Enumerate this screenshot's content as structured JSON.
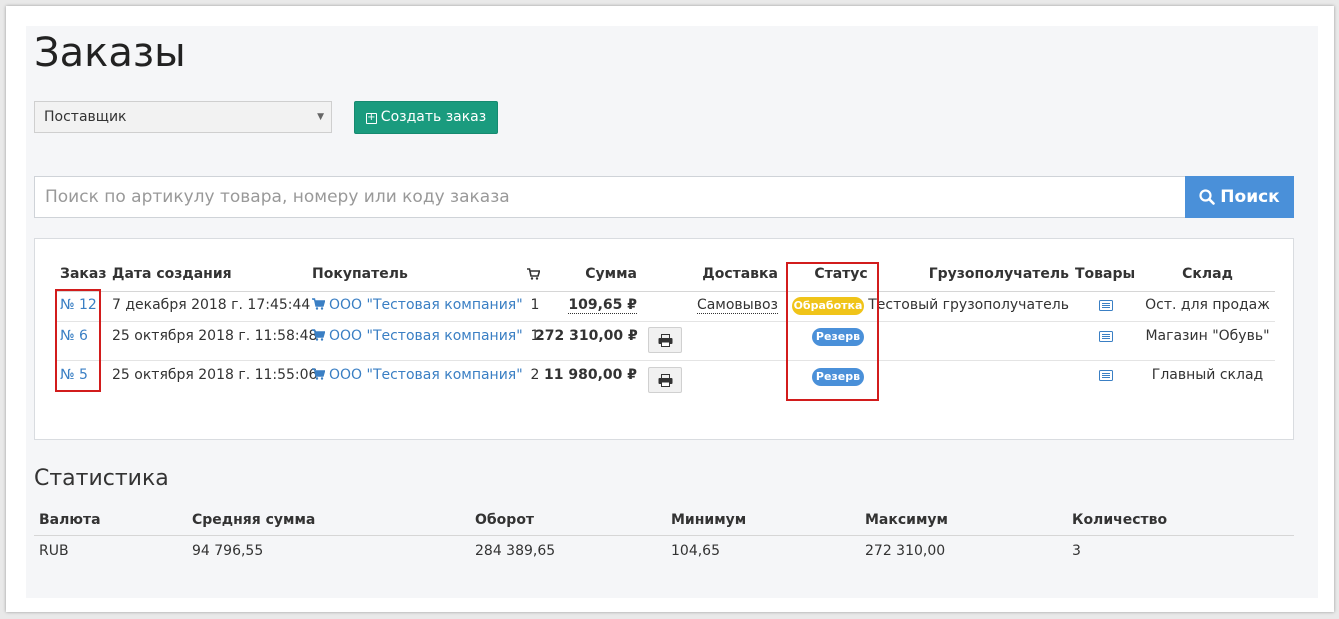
{
  "page": {
    "title": "Заказы"
  },
  "filters": {
    "supplier_value": "Поставщик",
    "create_label": "Создать заказ"
  },
  "search": {
    "placeholder": "Поиск по артикулу товара, номеру или коду заказа",
    "button_label": "Поиск"
  },
  "orders_table": {
    "headers": {
      "order": "Заказ",
      "date": "Дата создания",
      "buyer": "Покупатель",
      "sum": "Сумма",
      "delivery": "Доставка",
      "status": "Статус",
      "consignee": "Грузополучатель",
      "goods": "Товары",
      "warehouse": "Склад"
    },
    "rows": [
      {
        "order": "№ 12",
        "date": "7 декабря 2018 г. 17:45:44",
        "buyer": "ООО \"Тестовая компания\"",
        "qty": "1",
        "sum": "109,65 ₽",
        "delivery": "Самовывоз",
        "status": "Обработка",
        "consignee": "Тестовый грузополучатель",
        "warehouse": "Ост. для продаж"
      },
      {
        "order": "№ 6",
        "date": "25 октября 2018 г. 11:58:48",
        "buyer": "ООО \"Тестовая компания\"",
        "qty": "1",
        "sum": "272 310,00 ₽",
        "delivery": "",
        "status": "Резерв",
        "consignee": "",
        "warehouse": "Магазин \"Обувь\""
      },
      {
        "order": "№ 5",
        "date": "25 октября 2018 г. 11:55:06",
        "buyer": "ООО \"Тестовая компания\"",
        "qty": "2",
        "sum": "11 980,00 ₽",
        "delivery": "",
        "status": "Резерв",
        "consignee": "",
        "warehouse": "Главный склад"
      }
    ]
  },
  "stats": {
    "title": "Статистика",
    "headers": {
      "currency": "Валюта",
      "avg": "Средняя сумма",
      "turnover": "Оборот",
      "min": "Минимум",
      "max": "Максимум",
      "count": "Количество"
    },
    "row": {
      "currency": "RUB",
      "avg": "94 796,55",
      "turnover": "284 389,65",
      "min": "104,65",
      "max": "272 310,00",
      "count": "3"
    }
  },
  "colors": {
    "accent_green": "#1a9b7e",
    "accent_blue": "#4a90d9",
    "status_processing": "#f0c419",
    "status_reserve": "#4a90d9",
    "highlight_red": "#d21c1c"
  }
}
